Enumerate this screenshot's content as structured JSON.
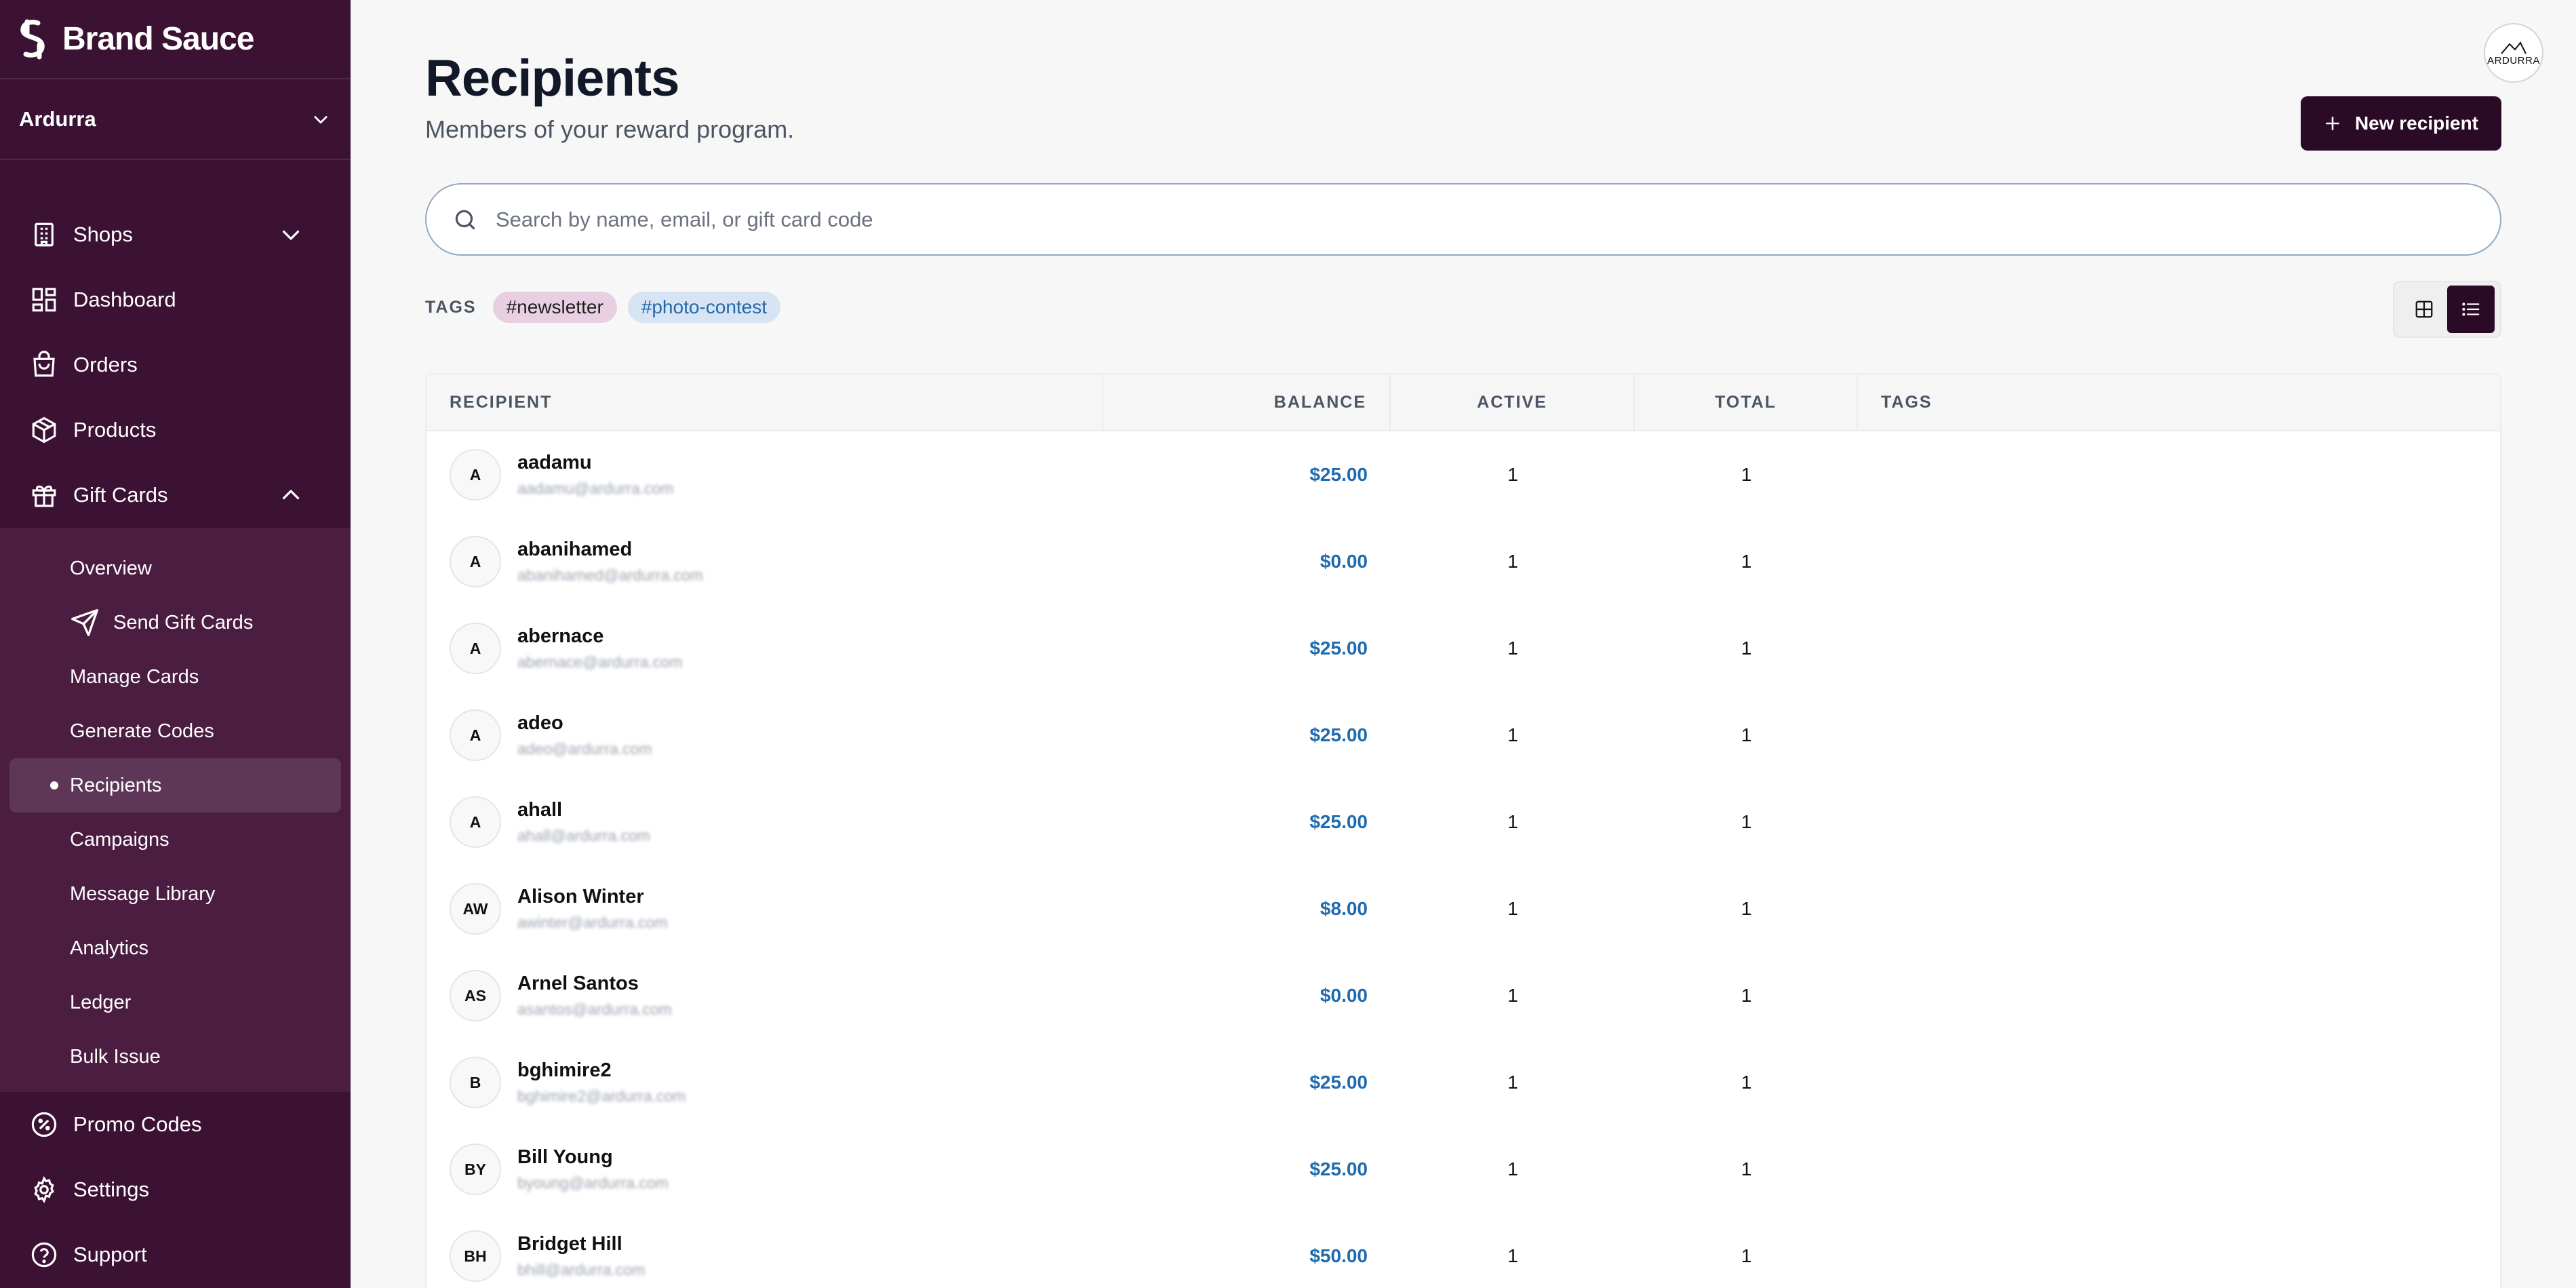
{
  "brand": {
    "name": "Brand Sauce"
  },
  "workspace": {
    "name": "Ardurra"
  },
  "sidebar": {
    "items": [
      {
        "label": "Shops",
        "icon": "building-icon"
      },
      {
        "label": "Dashboard",
        "icon": "dashboard-icon"
      },
      {
        "label": "Orders",
        "icon": "shopping-bag-icon"
      },
      {
        "label": "Products",
        "icon": "box-icon"
      },
      {
        "label": "Gift Cards",
        "icon": "gift-icon"
      }
    ],
    "gift_cards_sub": [
      {
        "label": "Overview"
      },
      {
        "label": "Send Gift Cards",
        "icon": "send-icon"
      },
      {
        "label": "Manage Cards"
      },
      {
        "label": "Generate Codes"
      },
      {
        "label": "Recipients",
        "active": true
      },
      {
        "label": "Campaigns"
      },
      {
        "label": "Message Library"
      },
      {
        "label": "Analytics"
      },
      {
        "label": "Ledger"
      },
      {
        "label": "Bulk Issue"
      }
    ],
    "bottom_items": [
      {
        "label": "Promo Codes",
        "icon": "percent-badge-icon"
      },
      {
        "label": "Settings",
        "icon": "gear-icon"
      },
      {
        "label": "Support",
        "icon": "help-circle-icon"
      }
    ]
  },
  "header": {
    "title": "Recipients",
    "subtitle": "Members of your reward program.",
    "new_button": "New recipient",
    "avatar_text": "ARDURRA"
  },
  "search": {
    "placeholder": "Search by name, email, or gift card code",
    "value": ""
  },
  "tags": {
    "label": "TAGS",
    "items": [
      "#newsletter",
      "#photo-contest"
    ]
  },
  "table": {
    "columns": [
      "RECIPIENT",
      "BALANCE",
      "ACTIVE",
      "TOTAL",
      "TAGS"
    ],
    "rows": [
      {
        "initials": "A",
        "name": "aadamu",
        "email": "aadamu@ardurra.com",
        "balance": "$25.00",
        "active": "1",
        "total": "1"
      },
      {
        "initials": "A",
        "name": "abanihamed",
        "email": "abanihamed@ardurra.com",
        "balance": "$0.00",
        "active": "1",
        "total": "1"
      },
      {
        "initials": "A",
        "name": "abernace",
        "email": "abernace@ardurra.com",
        "balance": "$25.00",
        "active": "1",
        "total": "1"
      },
      {
        "initials": "A",
        "name": "adeo",
        "email": "adeo@ardurra.com",
        "balance": "$25.00",
        "active": "1",
        "total": "1"
      },
      {
        "initials": "A",
        "name": "ahall",
        "email": "ahall@ardurra.com",
        "balance": "$25.00",
        "active": "1",
        "total": "1"
      },
      {
        "initials": "AW",
        "name": "Alison Winter",
        "email": "awinter@ardurra.com",
        "balance": "$8.00",
        "active": "1",
        "total": "1"
      },
      {
        "initials": "AS",
        "name": "Arnel Santos",
        "email": "asantos@ardurra.com",
        "balance": "$0.00",
        "active": "1",
        "total": "1"
      },
      {
        "initials": "B",
        "name": "bghimire2",
        "email": "bghimire2@ardurra.com",
        "balance": "$25.00",
        "active": "1",
        "total": "1"
      },
      {
        "initials": "BY",
        "name": "Bill Young",
        "email": "byoung@ardurra.com",
        "balance": "$25.00",
        "active": "1",
        "total": "1"
      },
      {
        "initials": "BH",
        "name": "Bridget Hill",
        "email": "bhill@ardurra.com",
        "balance": "$50.00",
        "active": "1",
        "total": "1"
      }
    ]
  },
  "colors": {
    "sidebar": "#3b1233",
    "accent": "#2b0a26",
    "balance": "#1f6bb0"
  }
}
